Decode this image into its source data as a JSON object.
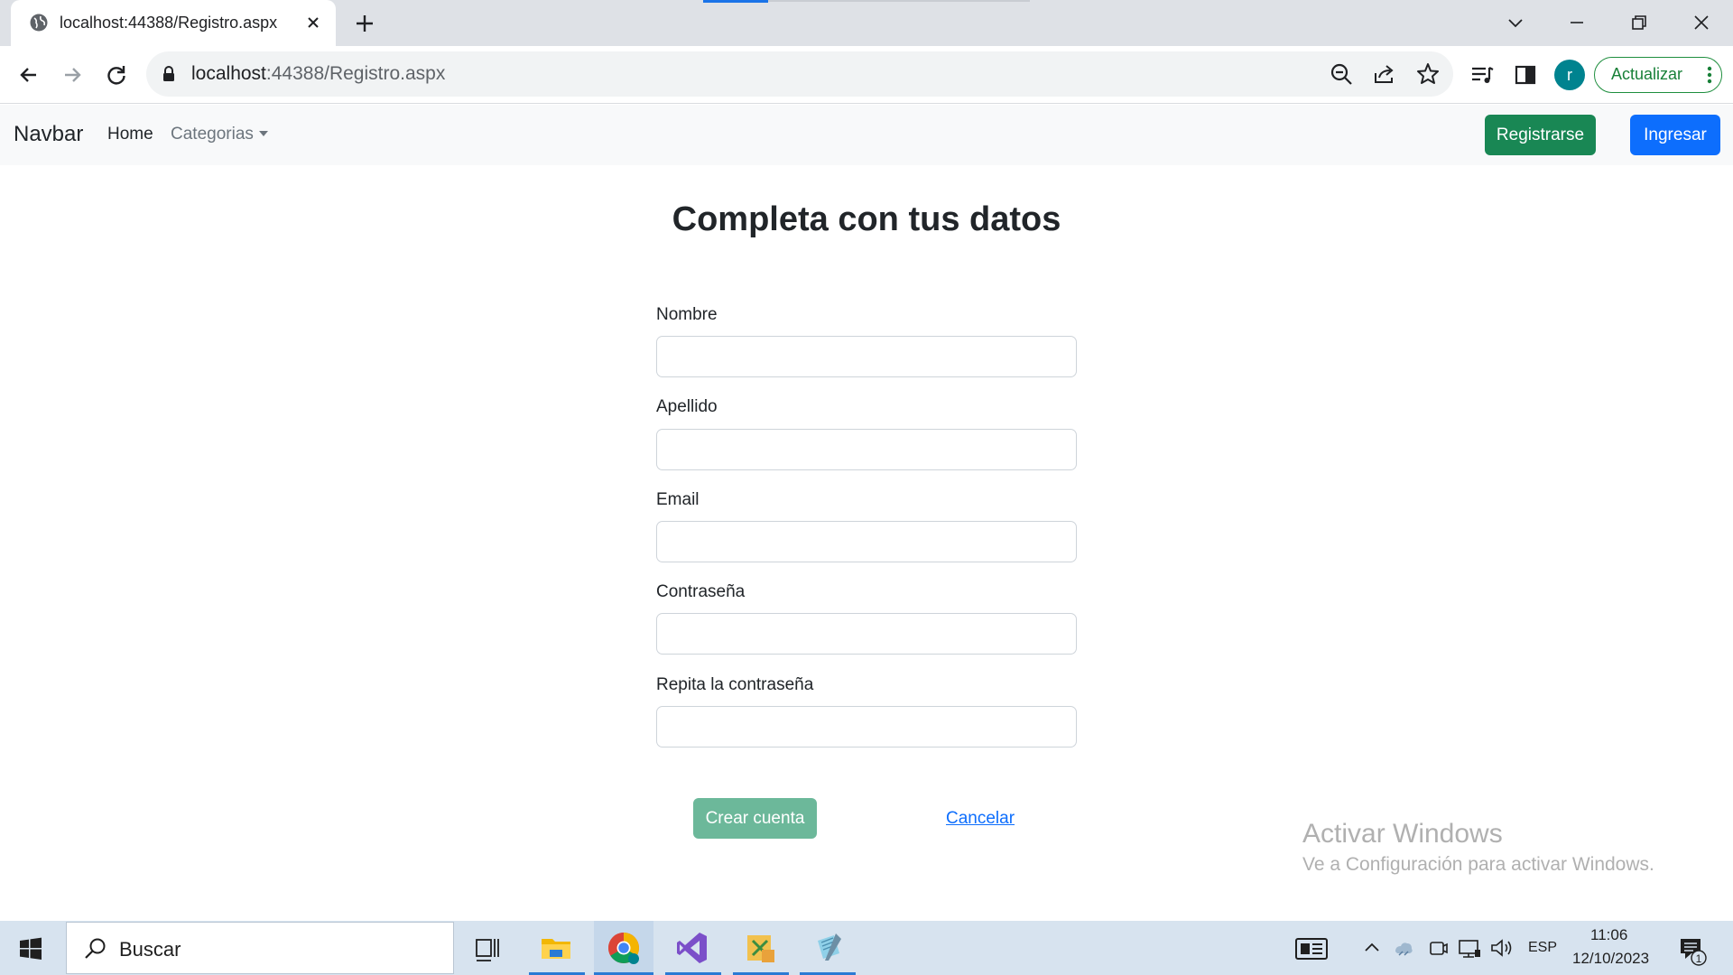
{
  "browser": {
    "tab_title": "localhost:44388/Registro.aspx",
    "url_host": "localhost",
    "url_path": ":44388/Registro.aspx",
    "profile_initial": "r",
    "update_label": "Actualizar"
  },
  "navbar": {
    "brand": "Navbar",
    "home": "Home",
    "categories": "Categorias",
    "register": "Registrarse",
    "login": "Ingresar"
  },
  "form": {
    "title": "Completa con tus datos",
    "fields": [
      {
        "label": "Nombre",
        "value": ""
      },
      {
        "label": "Apellido",
        "value": ""
      },
      {
        "label": "Email",
        "value": ""
      },
      {
        "label": "Contraseña",
        "value": ""
      },
      {
        "label": "Repita la contraseña",
        "value": ""
      }
    ],
    "submit": "Crear cuenta",
    "cancel": "Cancelar"
  },
  "watermark": {
    "title": "Activar Windows",
    "subtitle": "Ve a Configuración para activar Windows."
  },
  "taskbar": {
    "search_placeholder": "Buscar",
    "language": "ESP",
    "time": "11:06",
    "date": "12/10/2023",
    "notification_count": "1"
  },
  "colors": {
    "success": "#198754",
    "primary": "#0d6efd",
    "success_disabled": "#6cb89a"
  }
}
